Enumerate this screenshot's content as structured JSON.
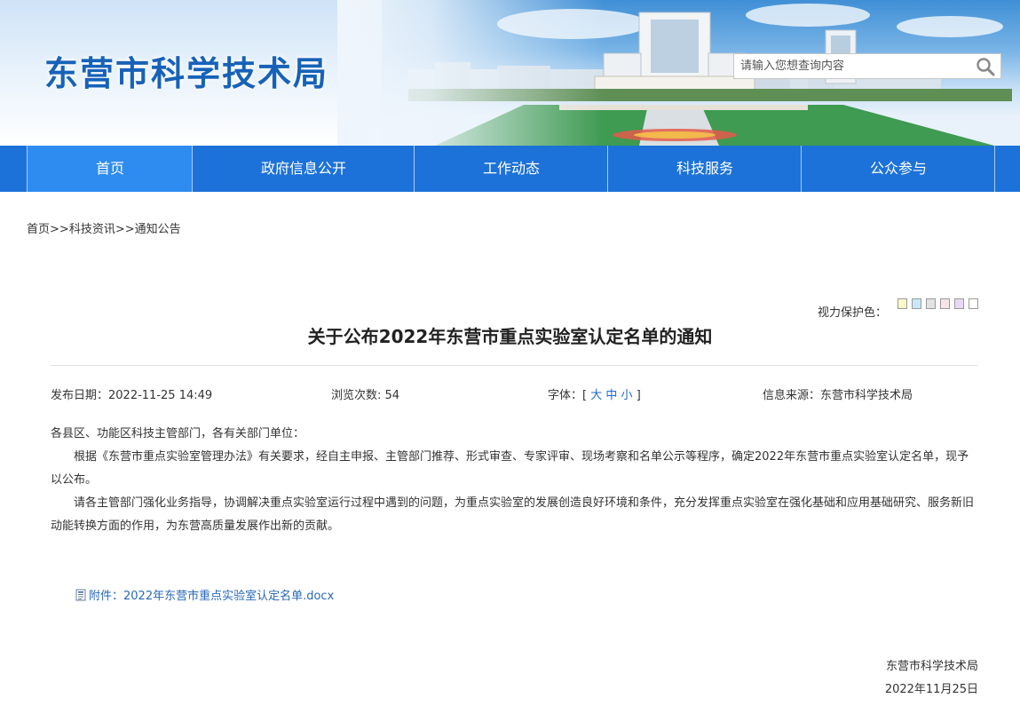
{
  "header": {
    "site_title": "东营市科学技术局",
    "search_placeholder": "请输入您想查询内容",
    "search_icon": "magnifier-icon"
  },
  "nav": {
    "items": [
      {
        "label": "首页",
        "active": true
      },
      {
        "label": "政府信息公开",
        "active": false
      },
      {
        "label": "工作动态",
        "active": false
      },
      {
        "label": "科技服务",
        "active": false
      },
      {
        "label": "公众参与",
        "active": false
      }
    ]
  },
  "breadcrumb": {
    "home": "首页",
    "sep": ">>",
    "level1": "科技资讯",
    "level2": "通知公告"
  },
  "eye_protect": {
    "label": "视力保护色：",
    "colors": [
      "#fafac8",
      "#c8e8f8",
      "#e2e2e2",
      "#f5e4ea",
      "#e8d8f5",
      "#ffffff"
    ]
  },
  "article": {
    "title": "关于公布2022年东营市重点实验室认定名单的通知",
    "publish_label": "发布日期：",
    "publish_date": "2022-11-25 14:49",
    "views_label": "浏览次数: ",
    "views": "54",
    "font_label": "字体：",
    "font_open": "[",
    "font_large": "大",
    "font_medium": "中",
    "font_small": "小",
    "font_close": "]",
    "source_label": "信息来源：",
    "source": "东营市科学技术局",
    "salutation": "各县区、功能区科技主管部门，各有关部门单位：",
    "paragraph1": "根据《东营市重点实验室管理办法》有关要求，经自主申报、主管部门推荐、形式审查、专家评审、现场考察和名单公示等程序，确定2022年东营市重点实验室认定名单，现予以公布。",
    "paragraph2": "请各主管部门强化业务指导，协调解决重点实验室运行过程中遇到的问题，为重点实验室的发展创造良好环境和条件，充分发挥重点实验室在强化基础和应用基础研究、服务新旧动能转换方面的作用，为东营高质量发展作出新的贡献。",
    "attachment": "附件：2022年东营市重点实验室认定名单.docx",
    "attachment_icon": "document-icon",
    "signature": "东营市科学技术局",
    "date": "2022年11月25日"
  },
  "colors": {
    "nav_bg": "#1c72d8",
    "nav_active": "#2e8cf0",
    "title_blue": "#1762b8",
    "link_blue": "#2868b8"
  }
}
